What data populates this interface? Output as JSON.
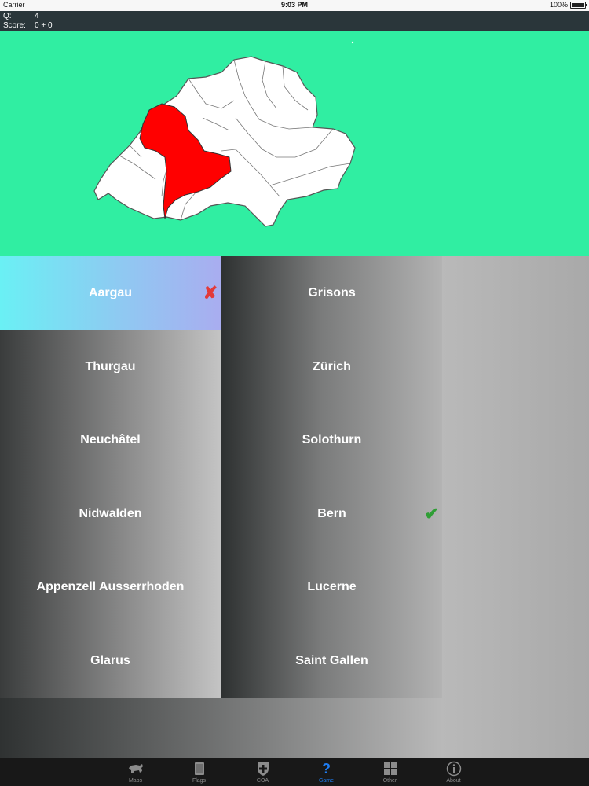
{
  "status": {
    "carrier": "Carrier",
    "time": "9:03 PM",
    "battery": "100%"
  },
  "info": {
    "q_label": "Q:",
    "q_value": "4",
    "score_label": "Score:",
    "score_value": "0 + 0"
  },
  "colors": {
    "map_bg": "#30eea2",
    "highlight_region": "#ff0000",
    "selected_choice": "#6af0f4",
    "tab_active": "#1e7cf0"
  },
  "choices": {
    "left": [
      {
        "label": "Aargau",
        "state": "wrong"
      },
      {
        "label": "Thurgau"
      },
      {
        "label": "Neuchâtel"
      },
      {
        "label": "Nidwalden"
      },
      {
        "label": "Appenzell Ausserrhoden"
      },
      {
        "label": "Glarus"
      }
    ],
    "right": [
      {
        "label": "Grisons"
      },
      {
        "label": "Zürich"
      },
      {
        "label": "Solothurn"
      },
      {
        "label": "Bern",
        "state": "correct"
      },
      {
        "label": "Lucerne"
      },
      {
        "label": "Saint Gallen"
      }
    ]
  },
  "tabs": [
    {
      "label": "Maps",
      "icon": "bull-icon"
    },
    {
      "label": "Flags",
      "icon": "flag-icon"
    },
    {
      "label": "COA",
      "icon": "shield-cross-icon"
    },
    {
      "label": "Game",
      "icon": "question-icon",
      "active": true
    },
    {
      "label": "Other",
      "icon": "grid-icon"
    },
    {
      "label": "About",
      "icon": "info-icon"
    }
  ]
}
